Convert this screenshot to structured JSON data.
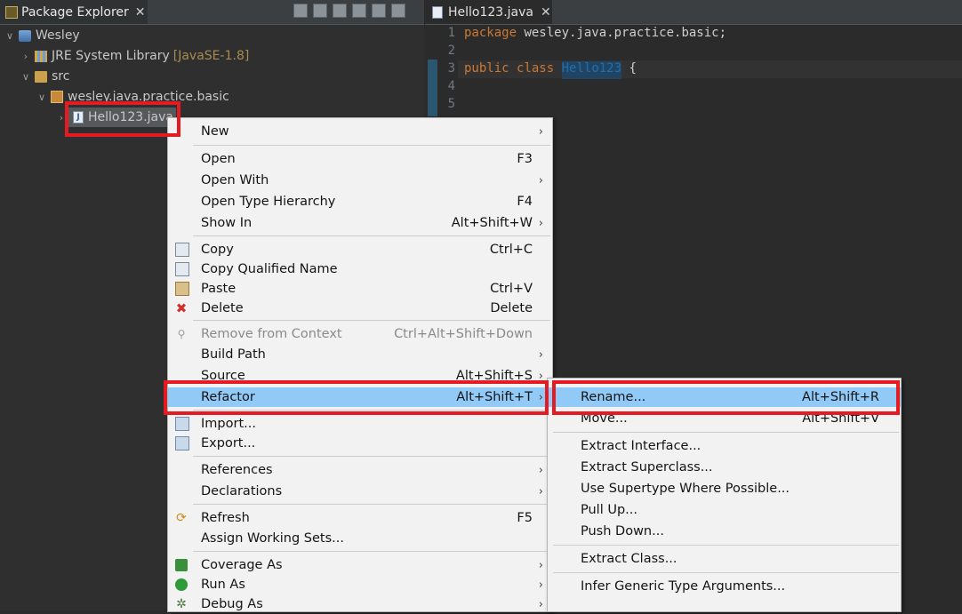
{
  "package_explorer": {
    "tab_title": "Package Explorer",
    "tree": [
      {
        "label": "Wesley",
        "icon": "project-icon"
      },
      {
        "label": "JRE System Library",
        "suffix": "[JavaSE-1.8]",
        "icon": "library-icon"
      },
      {
        "label": "src",
        "icon": "source-folder-icon"
      },
      {
        "label": "wesley.java.practice.basic",
        "icon": "package-icon"
      },
      {
        "label": "Hello123.java",
        "icon": "java-file-icon"
      }
    ]
  },
  "editor": {
    "tab_title": "Hello123.java",
    "lines": [
      {
        "n": "1",
        "kw1": "package",
        "text": " wesley.java.practice.basic;"
      },
      {
        "n": "2"
      },
      {
        "n": "3",
        "kw1": "public",
        "kw2": "class",
        "ident": "Hello123",
        "rest": " {"
      },
      {
        "n": "4"
      },
      {
        "n": "5"
      }
    ]
  },
  "context_menu": {
    "items": [
      {
        "label": "New",
        "arrow": "›"
      },
      {
        "label": "Open",
        "shortcut": "F3"
      },
      {
        "label": "Open With",
        "arrow": "›"
      },
      {
        "label": "Open Type Hierarchy",
        "shortcut": "F4"
      },
      {
        "label": "Show In",
        "shortcut": "Alt+Shift+W",
        "arrow": "›"
      },
      {
        "label": "Copy",
        "shortcut": "Ctrl+C",
        "icon": "copy-icon"
      },
      {
        "label": "Copy Qualified Name",
        "icon": "copy-qualified-name-icon"
      },
      {
        "label": "Paste",
        "shortcut": "Ctrl+V",
        "icon": "paste-icon"
      },
      {
        "label": "Delete",
        "shortcut": "Delete",
        "icon": "delete-icon"
      },
      {
        "label": "Remove from Context",
        "shortcut": "Ctrl+Alt+Shift+Down",
        "disabled": true,
        "icon": "remove-context-icon"
      },
      {
        "label": "Build Path",
        "arrow": "›"
      },
      {
        "label": "Source",
        "shortcut": "Alt+Shift+S",
        "arrow": "›"
      },
      {
        "label": "Refactor",
        "shortcut": "Alt+Shift+T",
        "arrow": "›",
        "highlighted": true
      },
      {
        "label": "Import...",
        "icon": "import-icon"
      },
      {
        "label": "Export...",
        "icon": "export-icon"
      },
      {
        "label": "References",
        "arrow": "›"
      },
      {
        "label": "Declarations",
        "arrow": "›"
      },
      {
        "label": "Refresh",
        "shortcut": "F5",
        "icon": "refresh-icon"
      },
      {
        "label": "Assign Working Sets..."
      },
      {
        "label": "Coverage As",
        "arrow": "›",
        "icon": "coverage-icon"
      },
      {
        "label": "Run As",
        "arrow": "›",
        "icon": "run-icon"
      },
      {
        "label": "Debug As",
        "arrow": "›",
        "icon": "debug-icon"
      }
    ]
  },
  "refactor_submenu": {
    "items": [
      {
        "label": "Rename...",
        "shortcut": "Alt+Shift+R",
        "highlighted": true
      },
      {
        "label": "Move...",
        "shortcut": "Alt+Shift+V"
      },
      {
        "label": "Extract Interface..."
      },
      {
        "label": "Extract Superclass..."
      },
      {
        "label": "Use Supertype Where Possible..."
      },
      {
        "label": "Pull Up..."
      },
      {
        "label": "Push Down..."
      },
      {
        "label": "Extract Class..."
      },
      {
        "label": "Infer Generic Type Arguments..."
      }
    ]
  },
  "colors": {
    "highlight": "#91c9f7",
    "annotation": "#e41b23",
    "keyword": "#cc7832"
  }
}
